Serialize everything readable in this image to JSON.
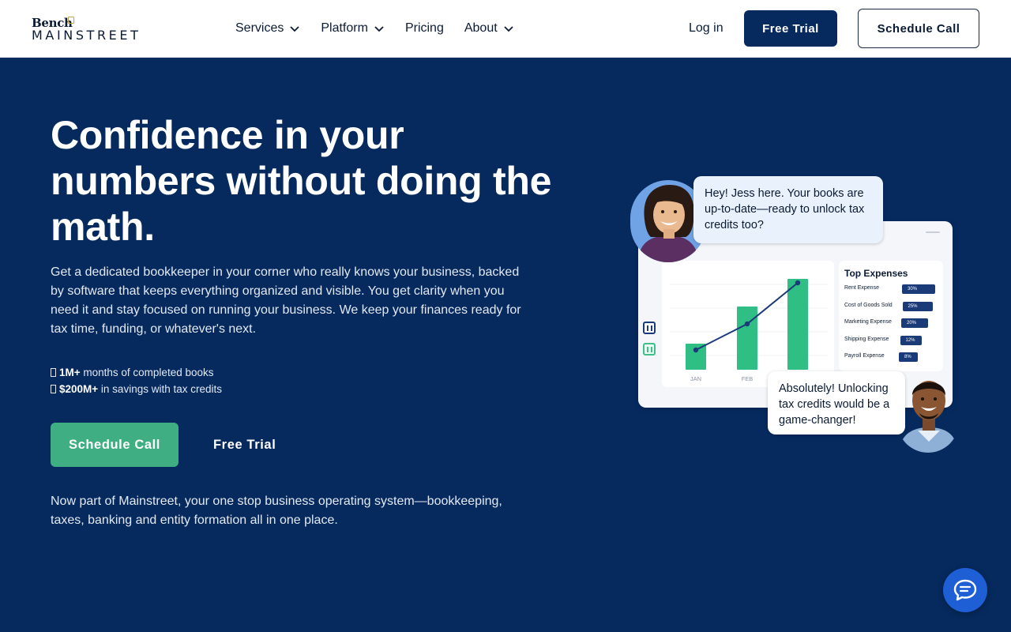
{
  "header": {
    "logo_top": "Bench",
    "logo_main": "MAINSTREET",
    "nav": [
      {
        "label": "Services",
        "dropdown": true
      },
      {
        "label": "Platform",
        "dropdown": true
      },
      {
        "label": "Pricing",
        "dropdown": false
      },
      {
        "label": "About",
        "dropdown": true
      }
    ],
    "login": "Log in",
    "free_trial": "Free Trial",
    "schedule_call": "Schedule Call"
  },
  "hero": {
    "headline": "Confidence in your numbers without doing the math.",
    "description": "Get a dedicated bookkeeper in your corner who really knows your business, backed by software that keeps everything organized and visible. You get clarity when you need it and stay focused on running your business. We keep your finances ready for tax time, funding, or whatever's next.",
    "stats": [
      {
        "value": "1M+",
        "text": " months of completed books"
      },
      {
        "value": "$200M+",
        "text": " in savings with tax credits"
      }
    ],
    "cta_primary": "Schedule Call",
    "cta_secondary": "Free Trial",
    "note": "Now part of Mainstreet, your one stop business operating system—bookkeeping, taxes, banking and entity formation all in one place."
  },
  "illustration": {
    "bubble_top": "Hey! Jess here. Your books are up-to-date—ready to unlock tax credits too?",
    "bubble_bottom": "Absolutely! Unlocking tax credits would be a game-changer!",
    "expenses_title": "Top Expenses",
    "expenses": [
      {
        "label": "Rent Expense",
        "pct": "30%",
        "value": 30
      },
      {
        "label": "Cost of Goods Sold",
        "pct": "25%",
        "value": 25
      },
      {
        "label": "Marketing Expense",
        "pct": "20%",
        "value": 20
      },
      {
        "label": "Shipping Expense",
        "pct": "12%",
        "value": 12
      },
      {
        "label": "Payroll Expense",
        "pct": "8%",
        "value": 8
      }
    ],
    "chart_months": [
      "JAN",
      "FEB"
    ],
    "chart_bars": [
      33,
      80,
      115
    ],
    "chart_line": [
      12,
      45,
      97
    ],
    "colors": {
      "bar": "#2fbf85",
      "line": "#1b3a78",
      "navy": "#062a5e",
      "green": "#3fae82"
    }
  },
  "chat": {
    "icon": "chat-icon"
  }
}
